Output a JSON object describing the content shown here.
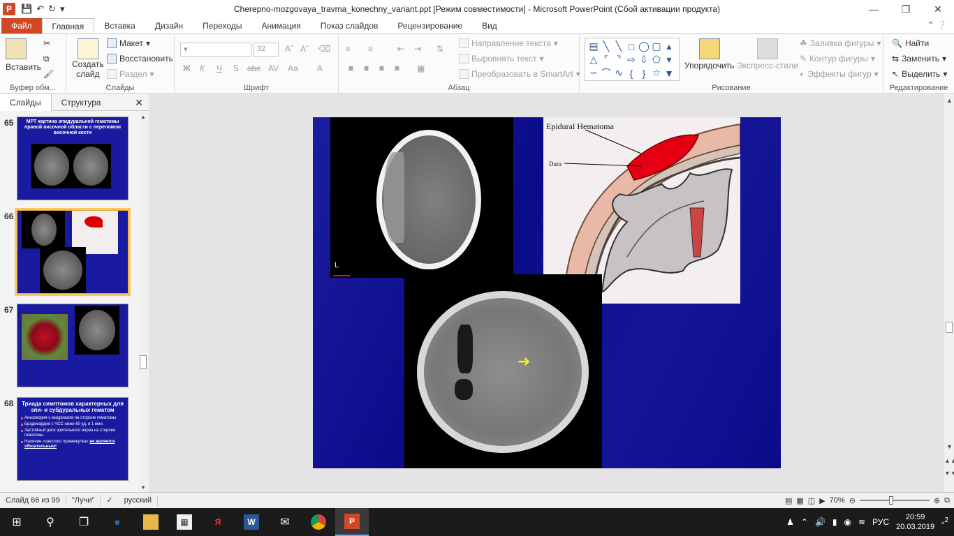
{
  "window": {
    "title": "Cherepno-mozgovaya_travma_konechny_variant.ppt [Режим совместимости]  -  Microsoft PowerPoint (Сбой активации продукта)"
  },
  "ribbon_tabs": [
    "Файл",
    "Главная",
    "Вставка",
    "Дизайн",
    "Переходы",
    "Анимация",
    "Показ слайдов",
    "Рецензирование",
    "Вид"
  ],
  "ribbon": {
    "clipboard": {
      "paste": "Вставить",
      "label": "Буфер обм..."
    },
    "slides": {
      "new_slide_line1": "Создать",
      "new_slide_line2": "слайд",
      "layout": "Макет",
      "reset": "Восстановить",
      "section": "Раздел",
      "label": "Слайды"
    },
    "font": {
      "size": "32",
      "label": "Шрифт",
      "bold": "Ж",
      "italic": "К",
      "underline": "Ч",
      "shadow": "S",
      "strike": "abc",
      "case": "Aa",
      "color": "A"
    },
    "paragraph": {
      "direction": "Направление текста",
      "align_text": "Выровнять текст",
      "smartart": "Преобразовать в SmartArt",
      "label": "Абзац"
    },
    "drawing": {
      "arrange": "Упорядочить",
      "quick_styles": "Экспресс-стили",
      "fill": "Заливка фигуры",
      "outline": "Контур фигуры",
      "effects": "Эффекты фигур",
      "label": "Рисование"
    },
    "editing": {
      "find": "Найти",
      "replace": "Заменить",
      "select": "Выделить",
      "label": "Редактирование"
    }
  },
  "pane": {
    "tabs": [
      "Слайды",
      "Структура"
    ],
    "slides": [
      {
        "num": "65",
        "title": "МРТ картина эпидуральной гематомы правой височной области с переломом височной кости"
      },
      {
        "num": "66",
        "title": ""
      },
      {
        "num": "67",
        "title": ""
      },
      {
        "num": "68",
        "title": "Триада симптомов характерных для эпи- и субдуральных гематом",
        "bullets": [
          "Анизокория с мидриазом на стороне гематомы",
          "Брадикардия с ЧСС ниже 60 уд. в 1 мин.",
          "Застойный диск зрительного нерва на стороне гематомы"
        ],
        "last_bullet_prefix": "Наличие «светлого промежутка» ",
        "last_bullet_emph": "не является обязательным!"
      }
    ]
  },
  "slide": {
    "img1_label": "L",
    "img2_label_hematoma": "Epidural Hematoma",
    "img2_label_dura": "Dura"
  },
  "status": {
    "slide_info": "Слайд 66 из 99",
    "theme": "\"Лучи\"",
    "language": "русский",
    "zoom": "70%",
    "zoom_fraction": 0.45
  },
  "taskbar": {
    "lang": "РУС",
    "time": "20:59",
    "date": "20.03.2019",
    "notifications": "2"
  }
}
